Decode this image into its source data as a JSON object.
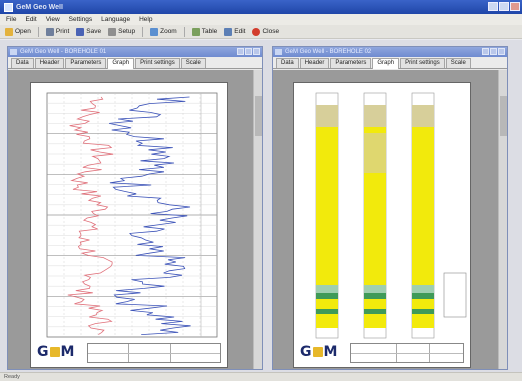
{
  "app": {
    "title": "GeM Geo Well"
  },
  "menu": [
    "File",
    "Edit",
    "View",
    "Settings",
    "Language",
    "Help"
  ],
  "toolbar": [
    {
      "label": "Open",
      "icon": "open-icon",
      "color": "#e3b23c"
    },
    {
      "label": "Print",
      "icon": "print-icon",
      "color": "#6f7f9c"
    },
    {
      "label": "Save",
      "icon": "save-icon",
      "color": "#4a63b5"
    },
    {
      "label": "Setup",
      "icon": "setup-icon",
      "color": "#8f8f8f"
    },
    {
      "label": "Zoom",
      "icon": "zoom-icon",
      "color": "#5a8fd0"
    },
    {
      "label": "Table",
      "icon": "table-icon",
      "color": "#7a9f5c"
    },
    {
      "label": "Edit",
      "icon": "edit-icon",
      "color": "#5c7fb5"
    },
    {
      "label": "Close",
      "icon": "close-icon",
      "color": "#d23c2c"
    }
  ],
  "left_window": {
    "title": "GeM Geo Well - BOREHOLE 01",
    "tabs": [
      "Data",
      "Header",
      "Parameters",
      "Graph",
      "Print settings",
      "Scale"
    ],
    "active_tab": "Graph"
  },
  "right_window": {
    "title": "GeM Geo Well - BOREHOLE 02",
    "tabs": [
      "Data",
      "Header",
      "Parameters",
      "Graph",
      "Print settings",
      "Scale"
    ],
    "active_tab": "Graph"
  },
  "logo": {
    "g": "G",
    "m": "M",
    "accent": "#e7b82a",
    "brand": "#1c2a6b"
  },
  "colors": {
    "curve_red": "#e0707a",
    "curve_blue": "#3b52b8",
    "fill_yellow": "#f2ea0c",
    "band_beige": "#d7cf9a",
    "band_green": "#3f9a58",
    "band_teal": "#9fcfb0"
  },
  "status": {
    "text": "Ready"
  }
}
